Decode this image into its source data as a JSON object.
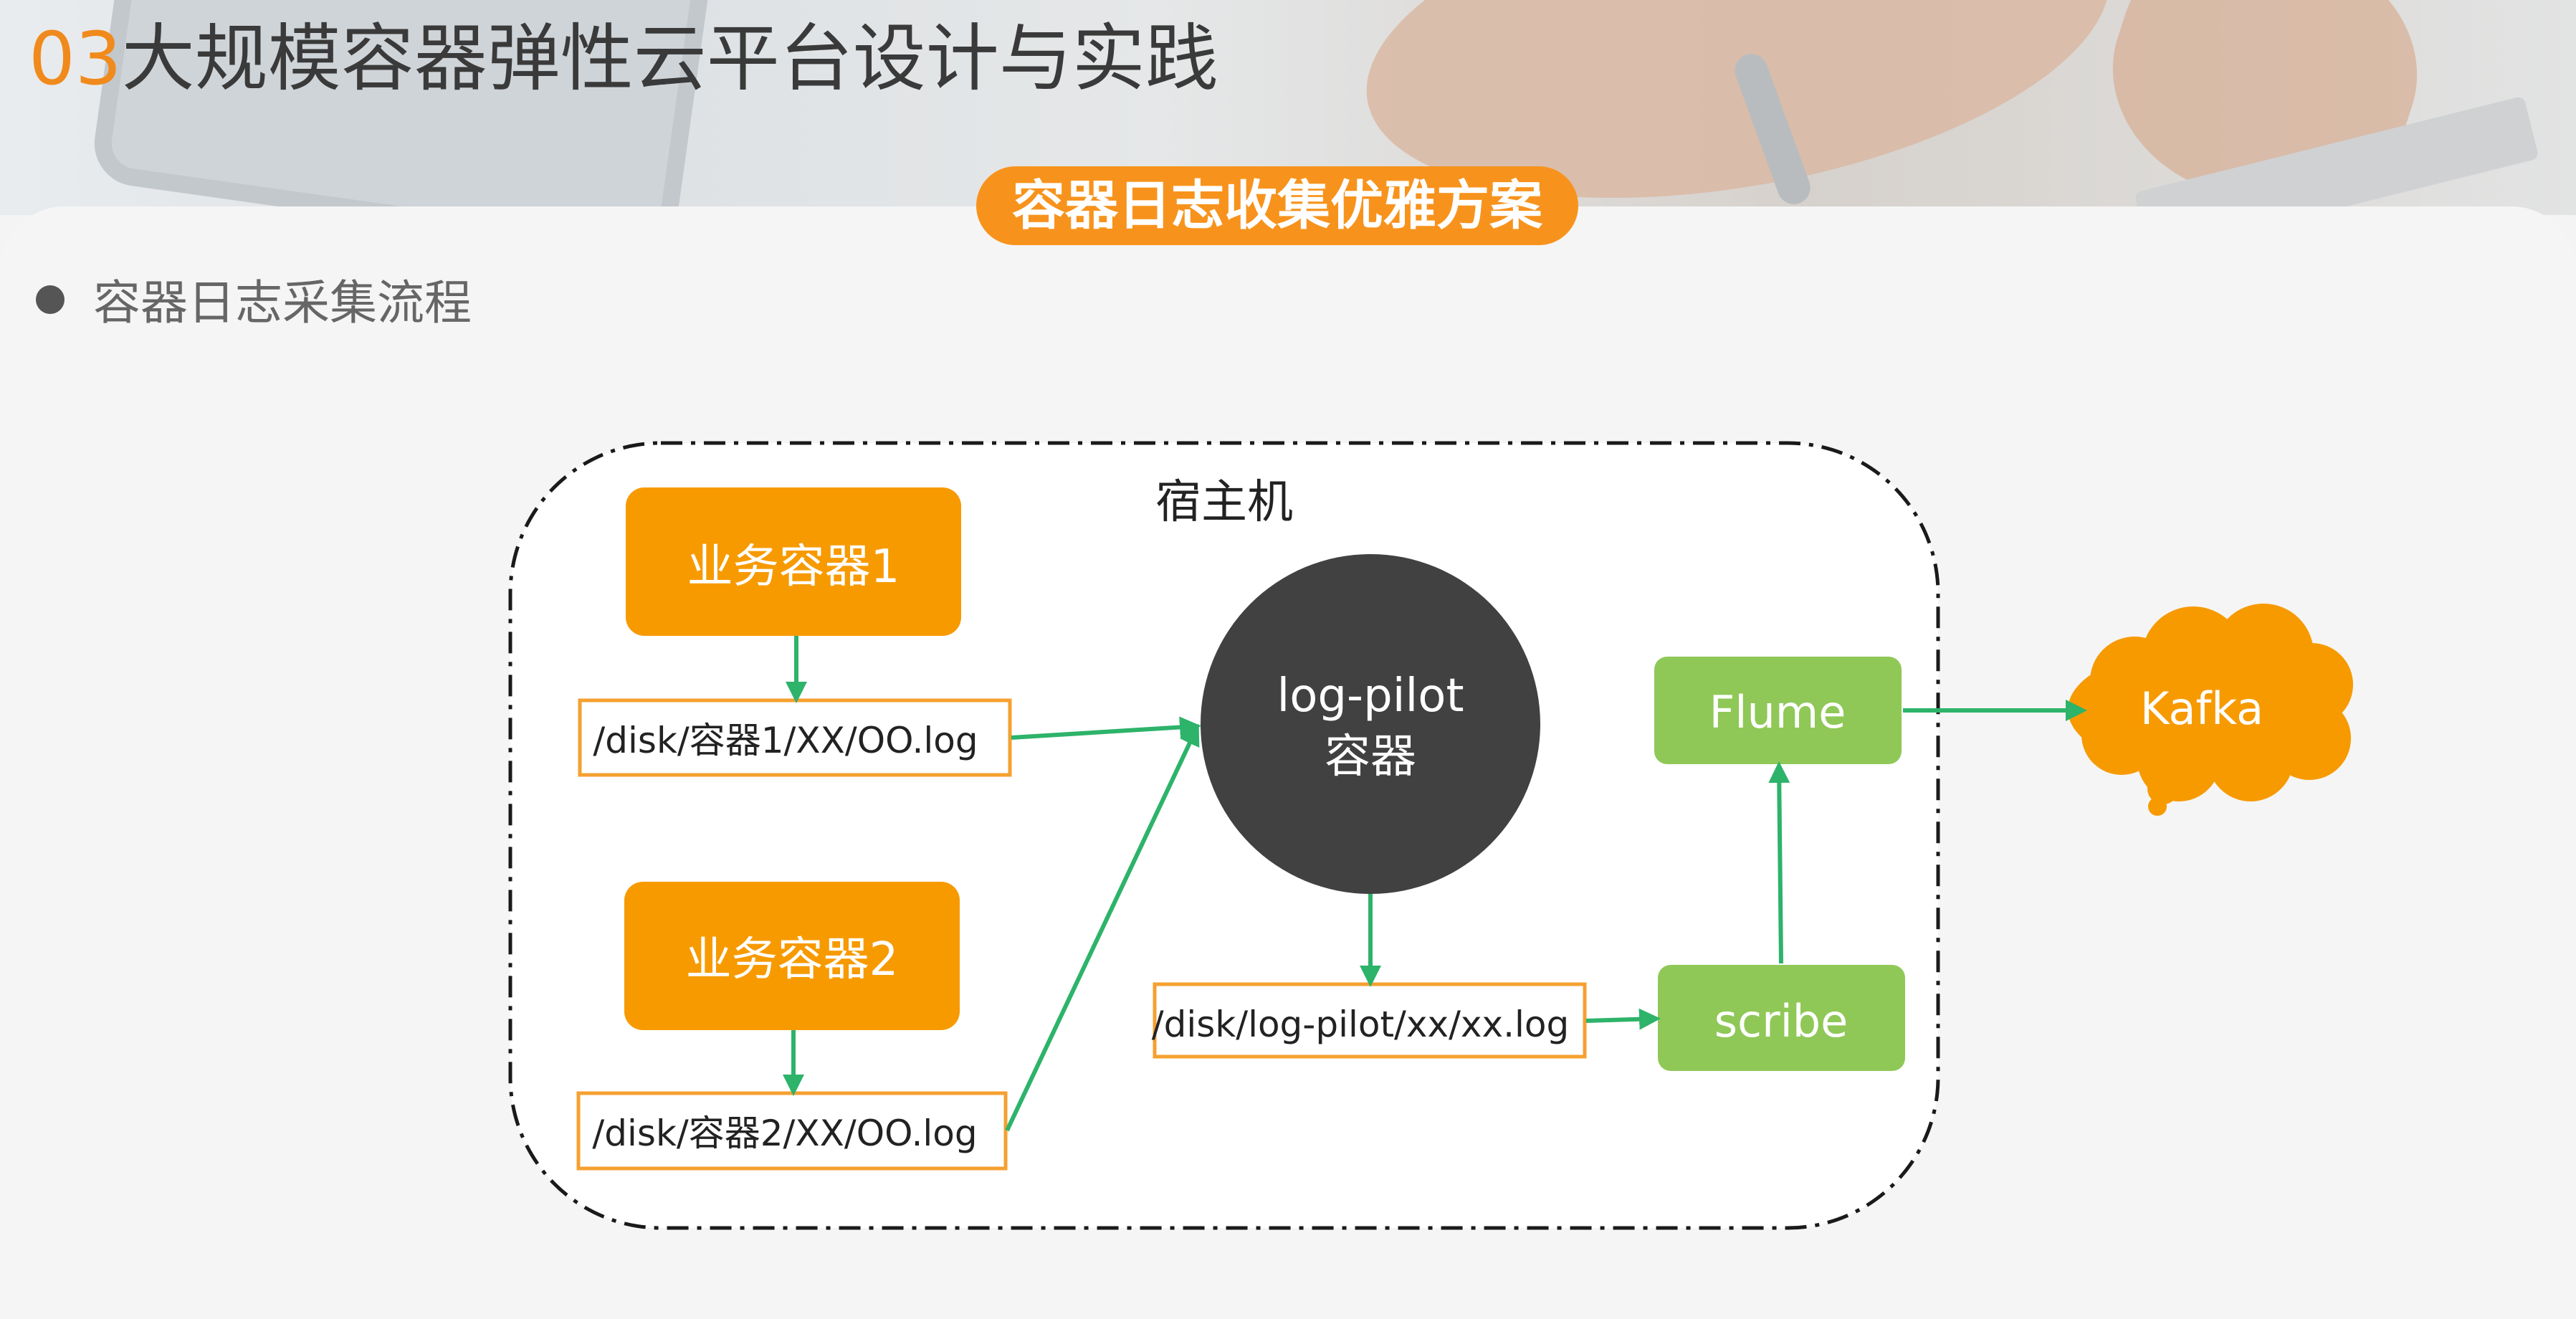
{
  "header": {
    "section_number": "03",
    "title": "大规模容器弹性云平台设计与实践",
    "subtitle": "容器日志收集优雅方案"
  },
  "content": {
    "bullet": "容器日志采集流程"
  },
  "diagram": {
    "host_label": "宿主机",
    "business_container_1": "业务容器1",
    "business_container_2": "业务容器2",
    "log_path_1": "/disk/容器1/XX/OO.log",
    "log_path_2": "/disk/容器2/XX/OO.log",
    "log_pilot_line1": "log-pilot",
    "log_pilot_line2": "容器",
    "pilot_log_path": "/disk/log-pilot/xx/xx.log",
    "scribe": "scribe",
    "flume": "Flume",
    "kafka": "Kafka"
  },
  "colors": {
    "orange": "#f79a00",
    "green": "#8fc857",
    "arrow": "#2db36a",
    "dark_circle": "#414141",
    "accent": "#f7931d"
  }
}
